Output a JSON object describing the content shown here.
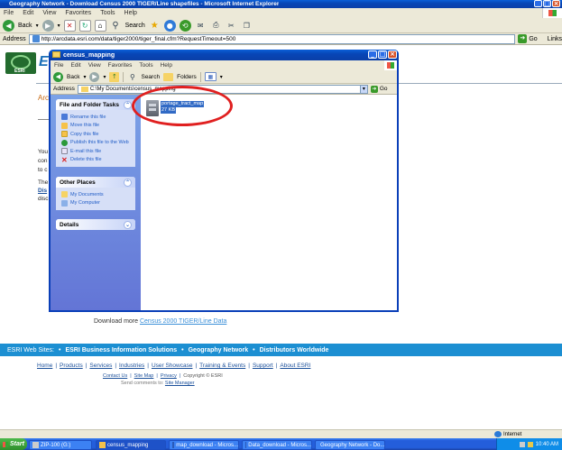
{
  "ie": {
    "title": "Geography Network - Download Census 2000 TIGER/Line shapefiles - Microsoft Internet Explorer",
    "menu": [
      "File",
      "Edit",
      "View",
      "Favorites",
      "Tools",
      "Help"
    ],
    "toolbar": {
      "back": "Back",
      "search": "Search"
    },
    "address_label": "Address",
    "address_value": "http://arcdata.esri.com/data/tiger2000/tiger_final.cfm?RequestTimeout=500",
    "go_label": "Go",
    "links_label": "Links"
  },
  "page": {
    "logo_letter": "E",
    "esri_tag": "ESRI",
    "arc_fragment": "Arc",
    "left_fragments": [
      "You",
      "con",
      "to c",
      "The",
      "Dis",
      "disc"
    ],
    "download_more_prefix": "Download more",
    "download_more_link": "Census 2000 TIGER/Line Data",
    "web_sites_label": "ESRI Web Sites:",
    "web_sites": [
      "ESRI Business Information Solutions",
      "Geography Network",
      "Distributors Worldwide"
    ],
    "footer_nav": [
      "Home",
      "Products",
      "Services",
      "Industries",
      "User Showcase",
      "Training & Events",
      "Support",
      "About ESRI"
    ],
    "footer_links": [
      "Contact Us",
      "Site Map",
      "Privacy",
      "Copyright © ESRI"
    ],
    "send_comments_prefix": "Send comments to:",
    "send_comments_link": "Site Manager"
  },
  "explorer": {
    "title": "census_mapping",
    "menu": [
      "File",
      "Edit",
      "View",
      "Favorites",
      "Tools",
      "Help"
    ],
    "toolbar": {
      "back": "Back",
      "search": "Search",
      "folders": "Folders"
    },
    "address_label": "Address",
    "address_value": "C:\\My Documents\\census_mapping",
    "go_label": "Go",
    "file_tasks_title": "File and Folder Tasks",
    "file_tasks": [
      "Rename this file",
      "Move this file",
      "Copy this file",
      "Publish this file to the Web",
      "E-mail this file",
      "Delete this file"
    ],
    "other_places_title": "Other Places",
    "other_places": [
      "My Documents",
      "My Computer"
    ],
    "details_title": "Details",
    "file_name": "portage_tract_map",
    "file_size": "27 KB"
  },
  "status": {
    "zone": "Internet"
  },
  "taskbar": {
    "start": "Start",
    "items": [
      "ZIP-100 (G:)",
      "census_mapping",
      "map_download - Micros...",
      "Data_download - Micros...",
      "Geography Network - Do..."
    ],
    "clock": "10:40 AM"
  },
  "colors": {
    "xp_blue": "#0a5fd8",
    "esri_blue": "#1a8fd0",
    "highlight_red": "#e02020",
    "selection": "#316ac5"
  }
}
